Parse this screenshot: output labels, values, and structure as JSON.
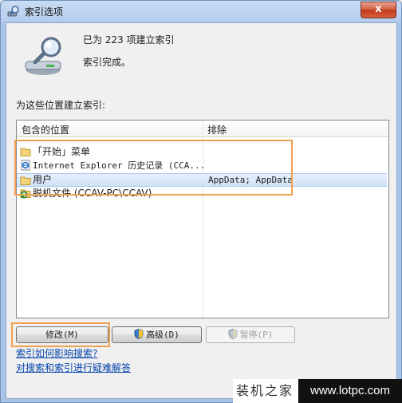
{
  "window": {
    "title": "索引选项",
    "close_label": "x"
  },
  "status": {
    "count_text": "已为 223 项建立索引",
    "message": "索引完成。"
  },
  "section_label": "为这些位置建立索引:",
  "list": {
    "columns": [
      "包含的位置",
      "排除"
    ],
    "rows": [
      {
        "icon": "folder-icon",
        "name": "「开始」菜单",
        "excluded": ""
      },
      {
        "icon": "ie-icon",
        "name": "Internet Explorer 历史记录 (CCA...",
        "excluded": ""
      },
      {
        "icon": "folder-icon",
        "name": "用户",
        "excluded": "AppData; AppData"
      },
      {
        "icon": "offline-files-icon",
        "name": "脱机文件 (CCAV-PC\\CCAV)",
        "excluded": ""
      }
    ]
  },
  "buttons": {
    "modify": "修改(M)",
    "advanced": "高级(D)",
    "pause": "暂停(P)"
  },
  "links": {
    "how_affects": "索引如何影响搜索?",
    "troubleshoot": "对搜索和索引进行疑难解答"
  },
  "watermark": {
    "name": "装机之家",
    "url": "www.lotpc.com"
  },
  "colors": {
    "highlight": "#f0a04f",
    "link": "#0645ad",
    "selection": "#cfe1f7"
  }
}
